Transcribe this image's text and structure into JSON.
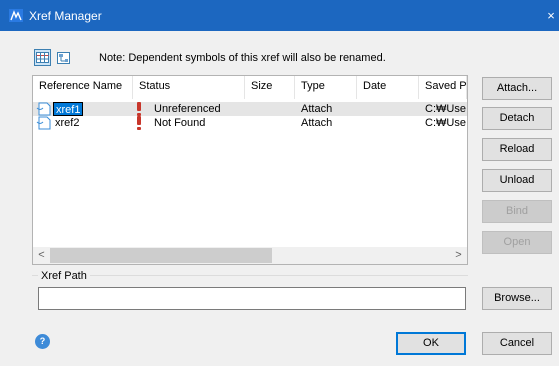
{
  "window": {
    "title": "Xref Manager",
    "close_glyph": "×",
    "icon": "autocad-icon"
  },
  "toolbar": {
    "list_view_icon": "list-view-icon",
    "tree_view_icon": "tree-view-icon",
    "note": "Note: Dependent symbols of this xref will also be renamed."
  },
  "table": {
    "columns": [
      "Reference Name",
      "Status",
      "Size",
      "Type",
      "Date",
      "Saved P"
    ],
    "rows": [
      {
        "name": "xref1",
        "status": "Unreferenced",
        "size": "",
        "type": "Attach",
        "date": "",
        "saved_path": "C:₩Use",
        "selected": true,
        "editing": true
      },
      {
        "name": "xref2",
        "status": "Not Found",
        "size": "",
        "type": "Attach",
        "date": "",
        "saved_path": "C:₩Use",
        "selected": false,
        "editing": false
      }
    ],
    "scroll_left_glyph": "<",
    "scroll_right_glyph": ">"
  },
  "buttons": {
    "attach": "Attach...",
    "detach": "Detach",
    "reload": "Reload",
    "unload": "Unload",
    "bind": "Bind",
    "open": "Open",
    "browse": "Browse...",
    "ok": "OK",
    "cancel": "Cancel"
  },
  "xref_path": {
    "label": "Xref Path",
    "value": ""
  },
  "help": {
    "glyph": "?"
  },
  "colors": {
    "titlebar": "#1c67c0",
    "selection": "#0078d7",
    "warning": "#c8362b"
  }
}
